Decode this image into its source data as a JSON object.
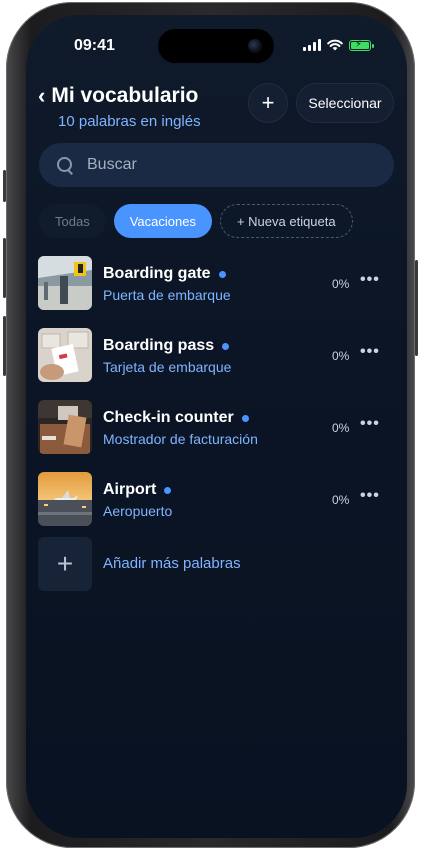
{
  "status_bar": {
    "time": "09:41"
  },
  "header": {
    "back_icon": "chevron-left-icon",
    "title": "Mi vocabulario",
    "subtitle": "10 palabras en inglés",
    "add_icon": "plus",
    "select_label": "Seleccionar"
  },
  "search": {
    "placeholder": "Buscar",
    "icon": "search-icon"
  },
  "tags": {
    "items": [
      {
        "label": "Todas",
        "active": false
      },
      {
        "label": "Vacaciones",
        "active": true
      }
    ],
    "new_tag_label": "+ Nueva etiqueta"
  },
  "words": [
    {
      "word": "Boarding gate",
      "translation": "Puerta de embarque",
      "progress": "0%"
    },
    {
      "word": "Boarding pass",
      "translation": "Tarjeta de embarque",
      "progress": "0%"
    },
    {
      "word": "Check-in counter",
      "translation": "Mostrador de facturación",
      "progress": "0%"
    },
    {
      "word": "Airport",
      "translation": "Aeropuerto",
      "progress": "0%"
    }
  ],
  "add_more_label": "Añadir más palabras",
  "colors": {
    "accent": "#4a94ff",
    "background": "#0b1525",
    "link": "#7fb4ff"
  }
}
